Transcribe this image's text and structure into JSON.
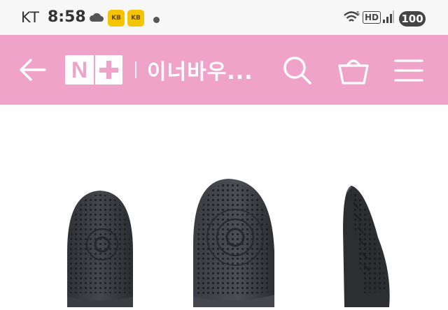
{
  "status_bar": {
    "carrier": "KT",
    "time": "8:58",
    "notification_app_label": "KB",
    "network_badge": "HD",
    "battery": "100"
  },
  "header": {
    "logo_letter": "N",
    "store_title": "이너바우...",
    "background_color": "#f0a3c8",
    "icons": [
      "back-arrow-icon",
      "search-icon",
      "shopping-basket-icon",
      "menu-icon"
    ]
  },
  "product_gallery": {
    "items": [
      "front-view",
      "angled-view",
      "side-view"
    ],
    "product_color": "#2b2d31"
  }
}
